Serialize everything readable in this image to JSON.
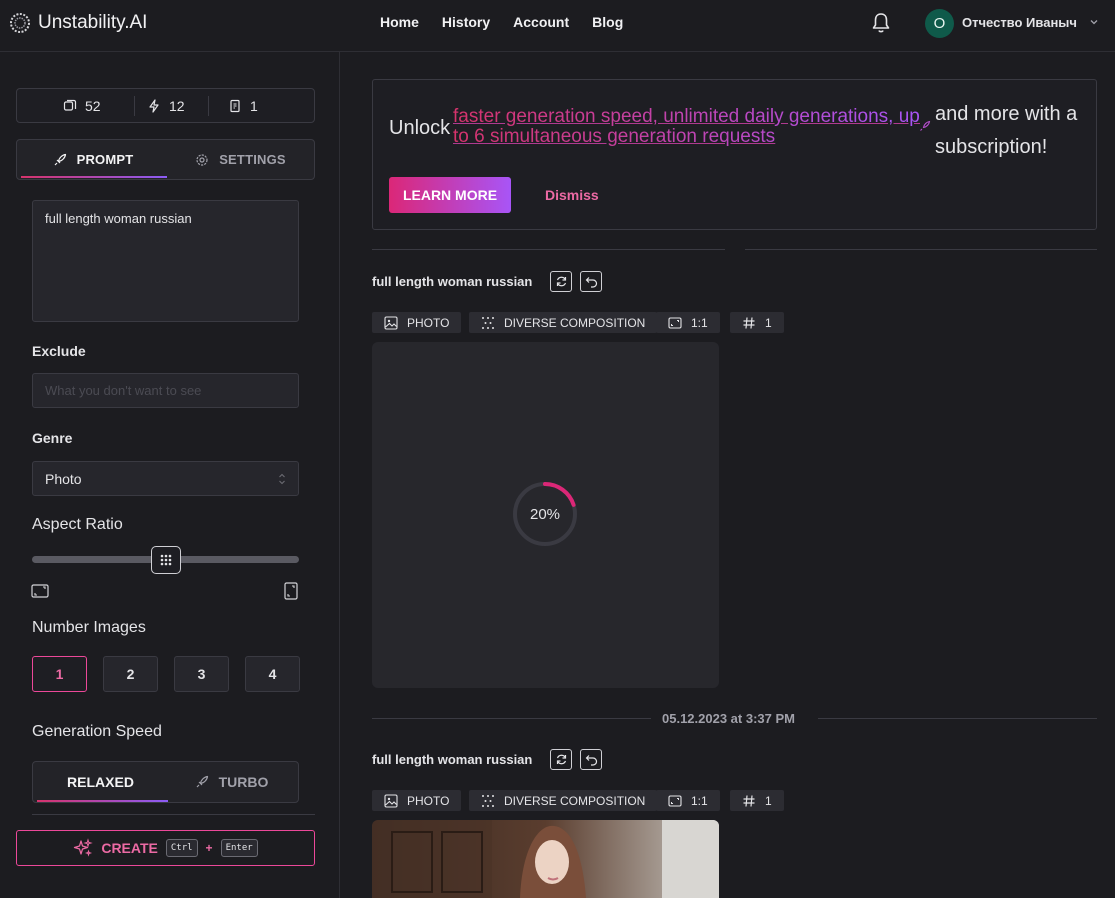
{
  "header": {
    "logo_text": "Unstability.AI",
    "nav": [
      "Home",
      "History",
      "Account",
      "Blog"
    ],
    "avatar_initial": "О",
    "username": "Отчество Иваныч"
  },
  "sidebar": {
    "stats": {
      "images": "52",
      "fast": "12",
      "slots": "1"
    },
    "tabs": {
      "prompt": "PROMPT",
      "settings": "SETTINGS",
      "active": "PROMPT"
    },
    "prompt_text": "full length woman russian",
    "exclude_label": "Exclude",
    "exclude_placeholder": "What you don't want to see",
    "exclude_value": "",
    "genre_label": "Genre",
    "genre_value": "Photo",
    "aspect_label": "Aspect Ratio",
    "aspect_value_fraction": 0.5,
    "number_label": "Number Images",
    "number_options": [
      "1",
      "2",
      "3",
      "4"
    ],
    "number_selected": "1",
    "speed_label": "Generation Speed",
    "speed_relaxed": "RELAXED",
    "speed_turbo": "TURBO",
    "speed_selected": "RELAXED",
    "create_label": "CREATE",
    "kbd_ctrl": "Ctrl",
    "kbd_plus": "+",
    "kbd_enter": "Enter"
  },
  "banner": {
    "unlock": "Unlock",
    "highlight": "faster generation speed, unlimited daily generations, up to 6 simultaneous generation requests",
    "rest": "and more with a subscription!",
    "learn_more": "LEARN MORE",
    "dismiss": "Dismiss"
  },
  "generations": [
    {
      "title": "full length woman russian",
      "tags": [
        "PHOTO",
        "DIVERSE COMPOSITION",
        "1:1",
        "1"
      ],
      "status": "loading",
      "progress_text": "20%",
      "progress_fraction": 0.2
    },
    {
      "date": "05.12.2023 at 3:37 PM",
      "title": "full length woman russian",
      "tags": [
        "PHOTO",
        "DIVERSE COMPOSITION",
        "1:1",
        "1"
      ],
      "status": "done"
    }
  ],
  "colors": {
    "accent_pink": "#ec4899",
    "accent_purple": "#a855f7",
    "background": "#1c1c20",
    "avatar": "#0f5a4a"
  }
}
